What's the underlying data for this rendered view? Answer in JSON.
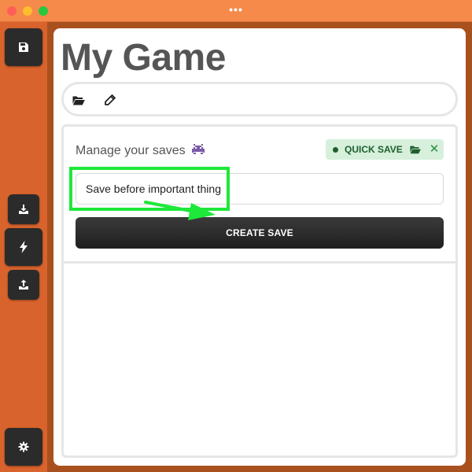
{
  "window": {
    "title_dots": "•••"
  },
  "sidebar": {
    "buttons": [
      {
        "name": "save",
        "icon": "floppy-disk-icon"
      },
      {
        "name": "download",
        "icon": "download-icon"
      },
      {
        "name": "quick-save",
        "icon": "lightning-icon"
      },
      {
        "name": "upload",
        "icon": "upload-icon"
      },
      {
        "name": "settings",
        "icon": "gear-icon"
      }
    ]
  },
  "main": {
    "title": "My Game",
    "toolbar": [
      {
        "name": "open",
        "icon": "folder-open-icon"
      },
      {
        "name": "edit",
        "icon": "pencil-icon"
      }
    ],
    "manage_label": "Manage your saves",
    "manage_emoji_icon": "space-invader-icon",
    "badge": {
      "label": "QUICK SAVE",
      "icons": [
        "folder-open-icon",
        "close-icon"
      ],
      "close_glyph": "✕",
      "color": "#1f5e2d",
      "background": "#d6f0dc"
    },
    "save_name_input": {
      "value": "Save before important thing",
      "placeholder": ""
    },
    "create_button_label": "CREATE SAVE"
  },
  "colors": {
    "titlebar": "#f58a4b",
    "sidebar": "#d9632c",
    "annotation_green": "#1ee83a"
  }
}
